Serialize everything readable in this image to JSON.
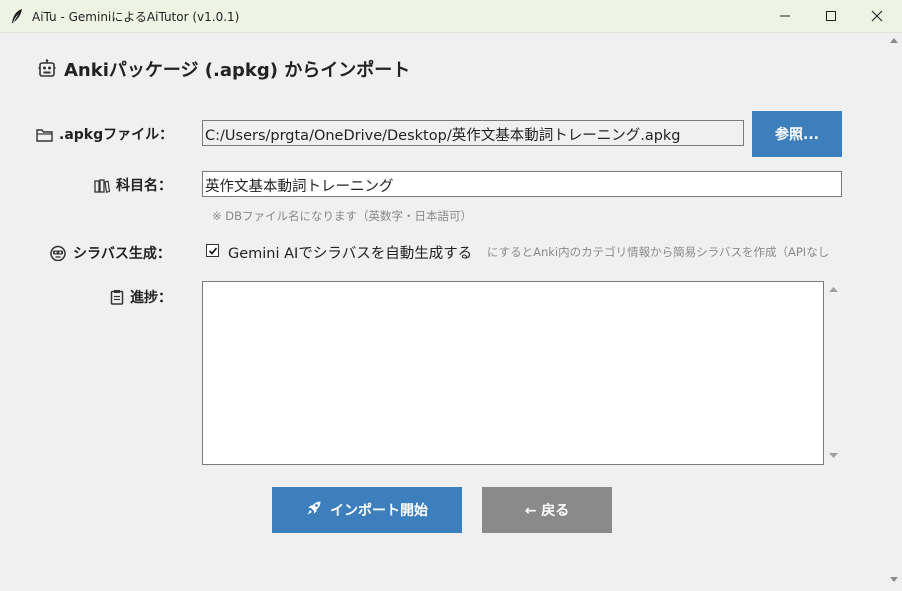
{
  "window": {
    "title": "AiTu - GeminiによるAiTutor (v1.0.1)",
    "controls": [
      "minimize-icon",
      "maximize-icon",
      "close-icon"
    ]
  },
  "page": {
    "heading": "Ankiパッケージ (.apkg) からインポート",
    "heading_icon": "robot-icon"
  },
  "form": {
    "file": {
      "label": ".apkgファイル：",
      "icon": "folder-icon",
      "value": "C:/Users/prgta/OneDrive/Desktop/英作文基本動詞トレーニング.apkg",
      "browse_label": "参照..."
    },
    "subject": {
      "label": "科目名：",
      "icon": "books-icon",
      "value": "英作文基本動詞トレーニング",
      "hint": "※ DBファイル名になります（英数字・日本語可）"
    },
    "syllabus": {
      "label": "シラバス生成：",
      "icon": "robot-face-icon",
      "checkbox_checked": true,
      "checkbox_label": "Gemini AIでシラバスを自動生成する",
      "note": "にするとAnki内のカテゴリ情報から簡易シラバスを作成（APIなし"
    },
    "progress": {
      "label": "進捗：",
      "icon": "clipboard-icon",
      "text": ""
    }
  },
  "actions": {
    "start_label": "インポート開始",
    "start_icon": "rocket-icon",
    "back_label": "← 戻る"
  },
  "colors": {
    "primary_button": "#3d7ebd",
    "secondary_button": "#8a8a8a",
    "titlebar": "#eef3e4",
    "background": "#f0f0f0"
  }
}
